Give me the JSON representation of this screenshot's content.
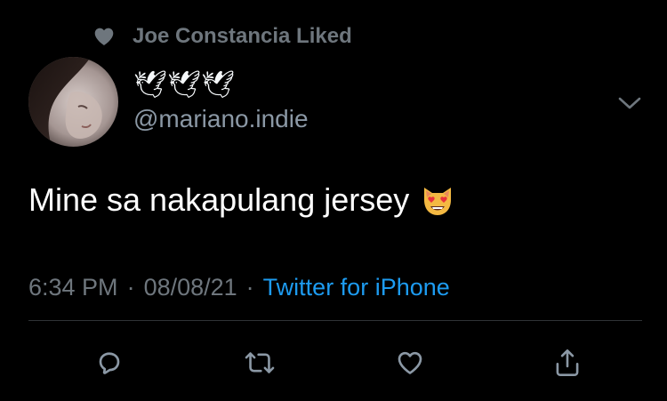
{
  "social_context": {
    "icon": "heart-icon",
    "text": "Joe Constancia Liked"
  },
  "author": {
    "display_name": "🕊🕊🕊",
    "handle": "@mariano.indie",
    "avatar_icon": "avatar"
  },
  "tweet": {
    "text": "Mine sa nakapulang jersey",
    "emoji": "heart-eyes-cat-emoji"
  },
  "meta": {
    "time": "6:34 PM",
    "separator": "·",
    "date": "08/08/21",
    "source": "Twitter for iPhone"
  },
  "actions": [
    {
      "name": "reply",
      "icon": "reply-icon"
    },
    {
      "name": "retweet",
      "icon": "retweet-icon"
    },
    {
      "name": "like",
      "icon": "heart-icon"
    },
    {
      "name": "share",
      "icon": "share-icon"
    }
  ],
  "colors": {
    "background": "#000000",
    "muted_text": "#6e767d",
    "link": "#1d9bf0",
    "divider": "#2f3336",
    "icon": "#8b98a5"
  }
}
